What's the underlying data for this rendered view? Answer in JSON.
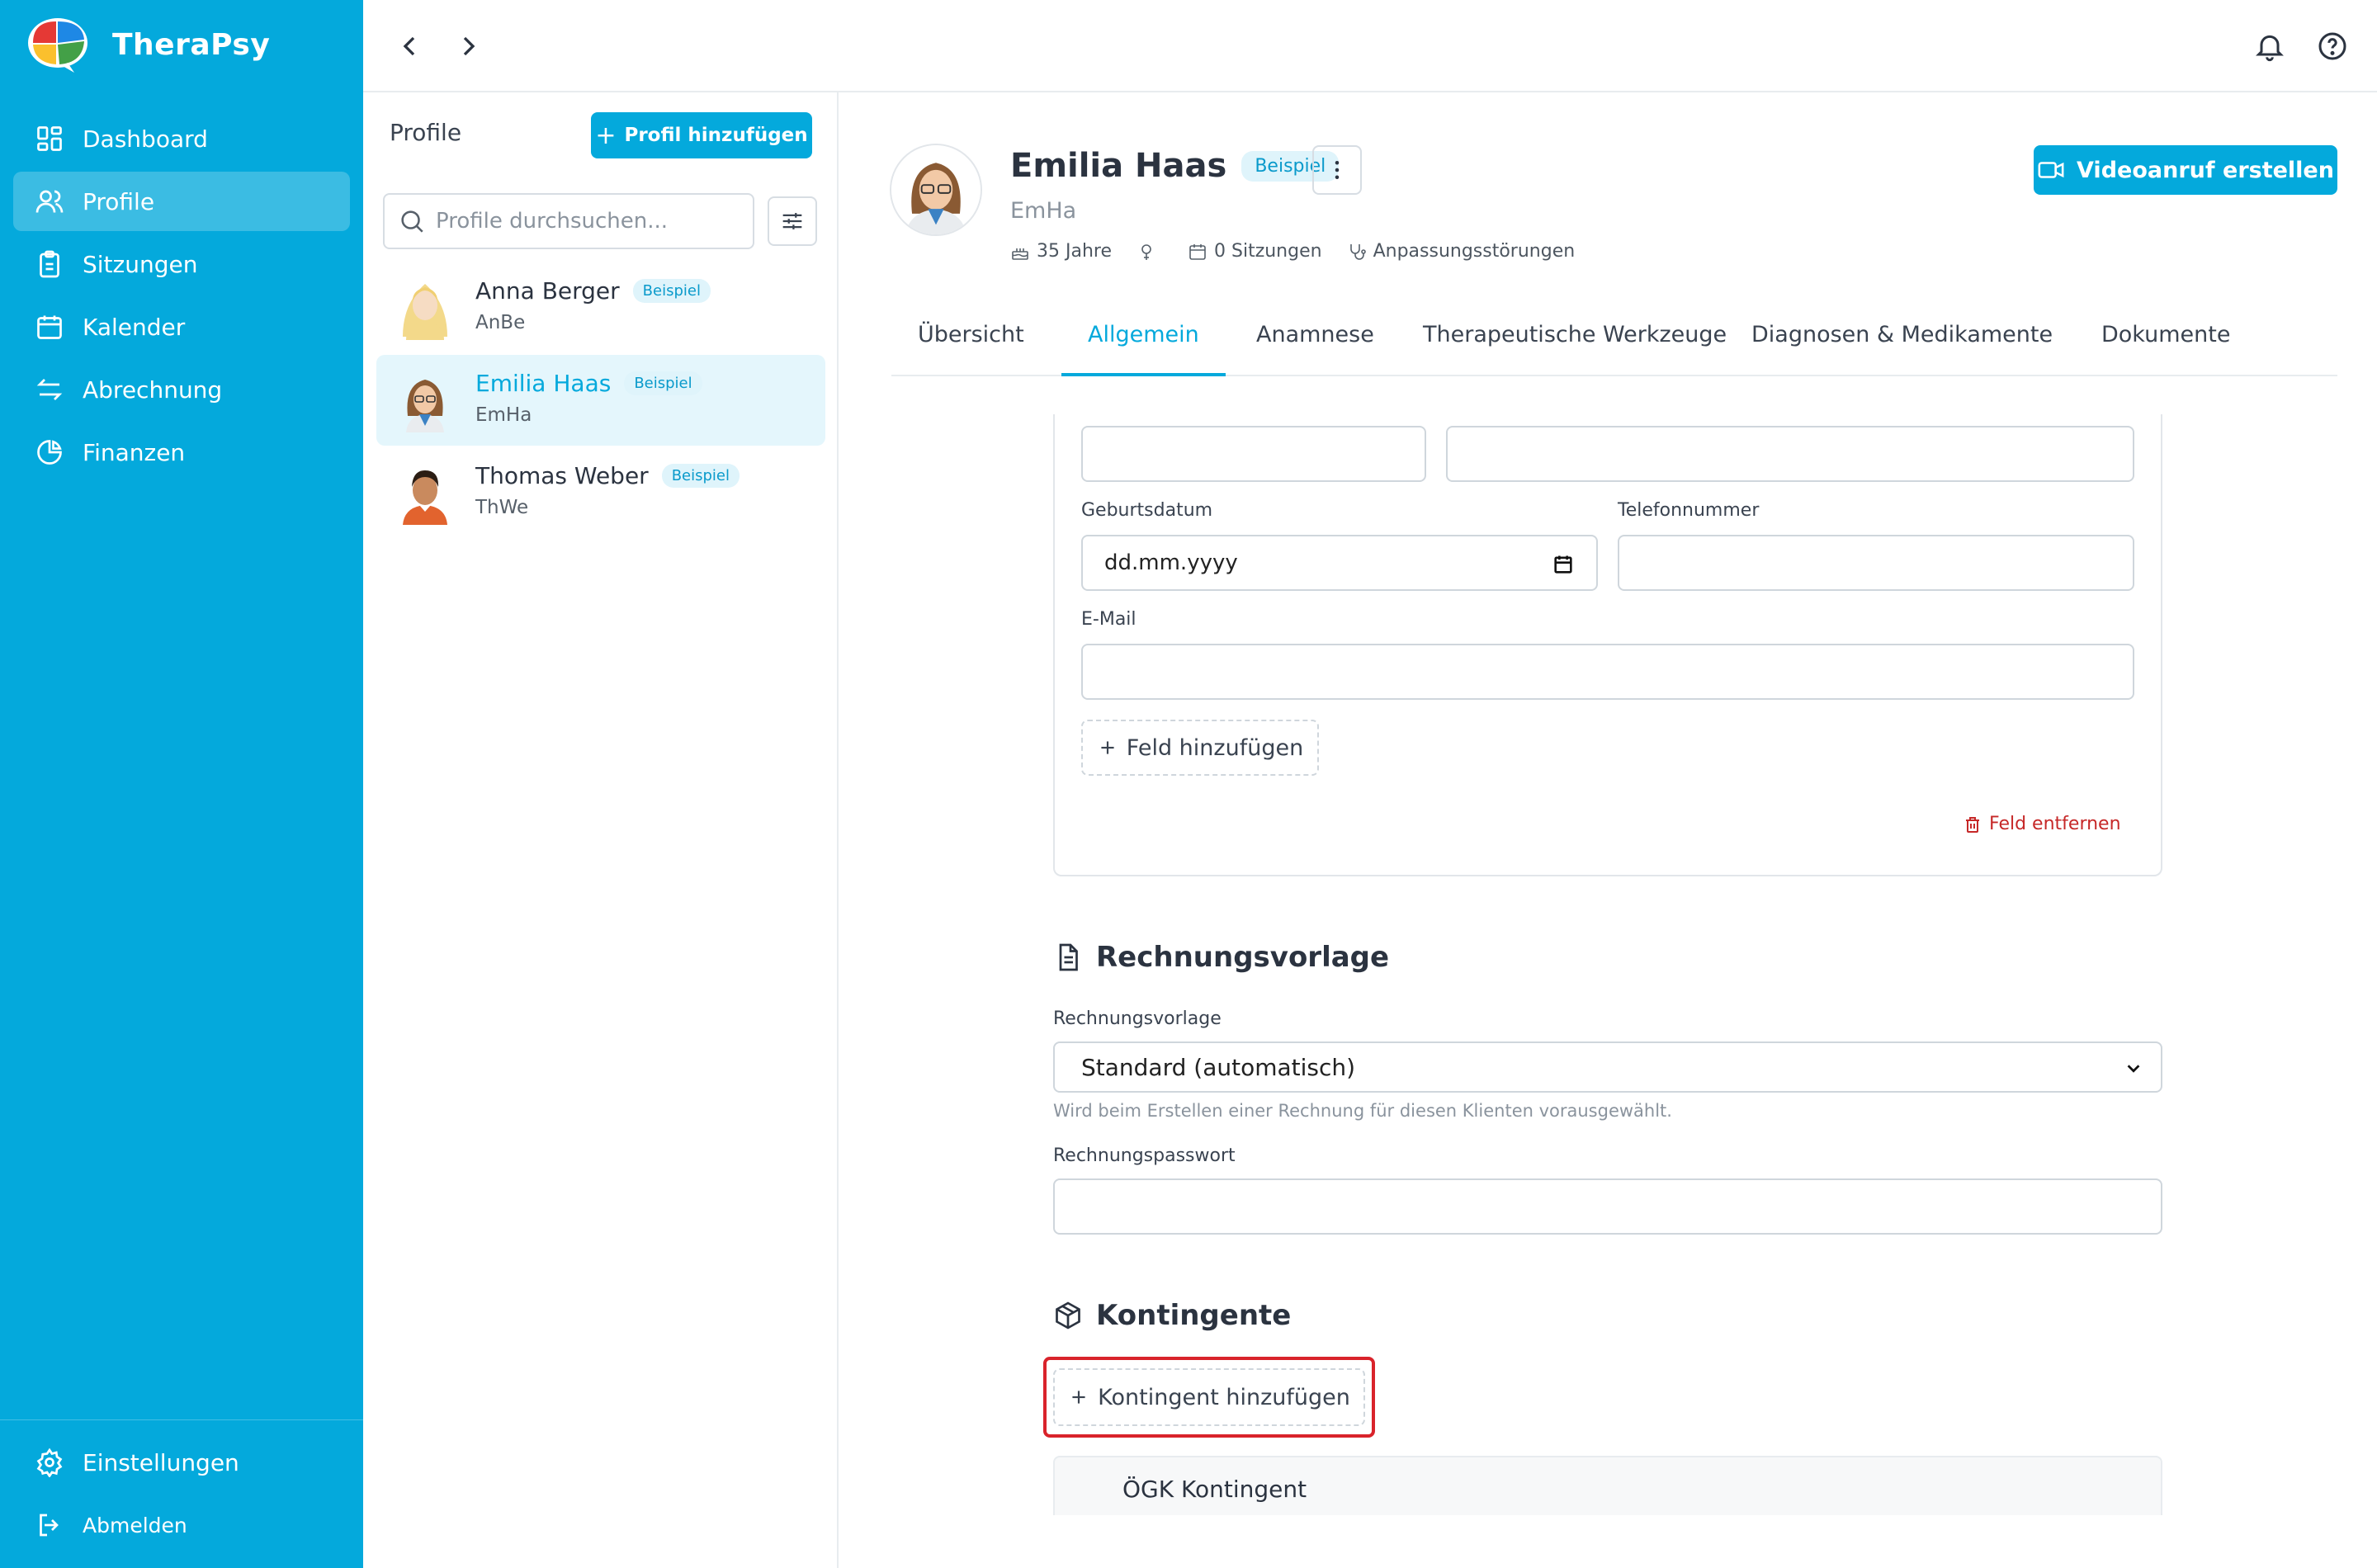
{
  "app": {
    "name": "TheraPsy"
  },
  "sidebar": {
    "items": [
      {
        "label": "Dashboard",
        "icon": "dashboard-icon"
      },
      {
        "label": "Profile",
        "icon": "users-icon",
        "active": true
      },
      {
        "label": "Sitzungen",
        "icon": "clipboard-icon"
      },
      {
        "label": "Kalender",
        "icon": "calendar-icon"
      },
      {
        "label": "Abrechnung",
        "icon": "arrows-exchange-icon"
      },
      {
        "label": "Finanzen",
        "icon": "pie-chart-icon"
      }
    ],
    "settings_label": "Einstellungen",
    "logout_label": "Abmelden"
  },
  "profiles_panel": {
    "title": "Profile",
    "add_button": "Profil hinzufügen",
    "search_placeholder": "Profile durchsuchen...",
    "profiles": [
      {
        "name": "Anna Berger",
        "badge": "Beispiel",
        "short": "AnBe"
      },
      {
        "name": "Emilia Haas",
        "badge": "Beispiel",
        "short": "EmHa",
        "active": true
      },
      {
        "name": "Thomas Weber",
        "badge": "Beispiel",
        "short": "ThWe"
      }
    ]
  },
  "detail": {
    "name": "Emilia Haas",
    "badge": "Beispiel",
    "short": "EmHa",
    "age": "35 Jahre",
    "sessions": "0 Sitzungen",
    "diagnosis": "Anpassungsstörungen",
    "video_button": "Videoanruf erstellen",
    "tabs": [
      "Übersicht",
      "Allgemein",
      "Anamnese",
      "Therapeutische Werkzeuge",
      "Diagnosen & Medikamente",
      "Dokumente"
    ],
    "active_tab": "Allgemein"
  },
  "form": {
    "birthdate_label": "Geburtsdatum",
    "birthdate_value": "dd.mm.yyyy",
    "phone_label": "Telefonnummer",
    "email_label": "E-Mail",
    "add_field": "Feld hinzufügen",
    "remove_field": "Feld entfernen"
  },
  "invoice": {
    "section_title": "Rechnungsvorlage",
    "template_label": "Rechnungsvorlage",
    "template_value": "Standard (automatisch)",
    "template_hint": "Wird beim Erstellen einer Rechnung für diesen Klienten vorausgewählt.",
    "password_label": "Rechnungspasswort"
  },
  "contingents": {
    "section_title": "Kontingente",
    "add_button": "Kontingent hinzufügen",
    "items": [
      {
        "title": "ÖGK Kontingent"
      }
    ]
  },
  "colors": {
    "brand": "#04a9dc",
    "badge_bg": "#dff4fb",
    "danger": "#c62828",
    "highlight": "#d9232b"
  }
}
